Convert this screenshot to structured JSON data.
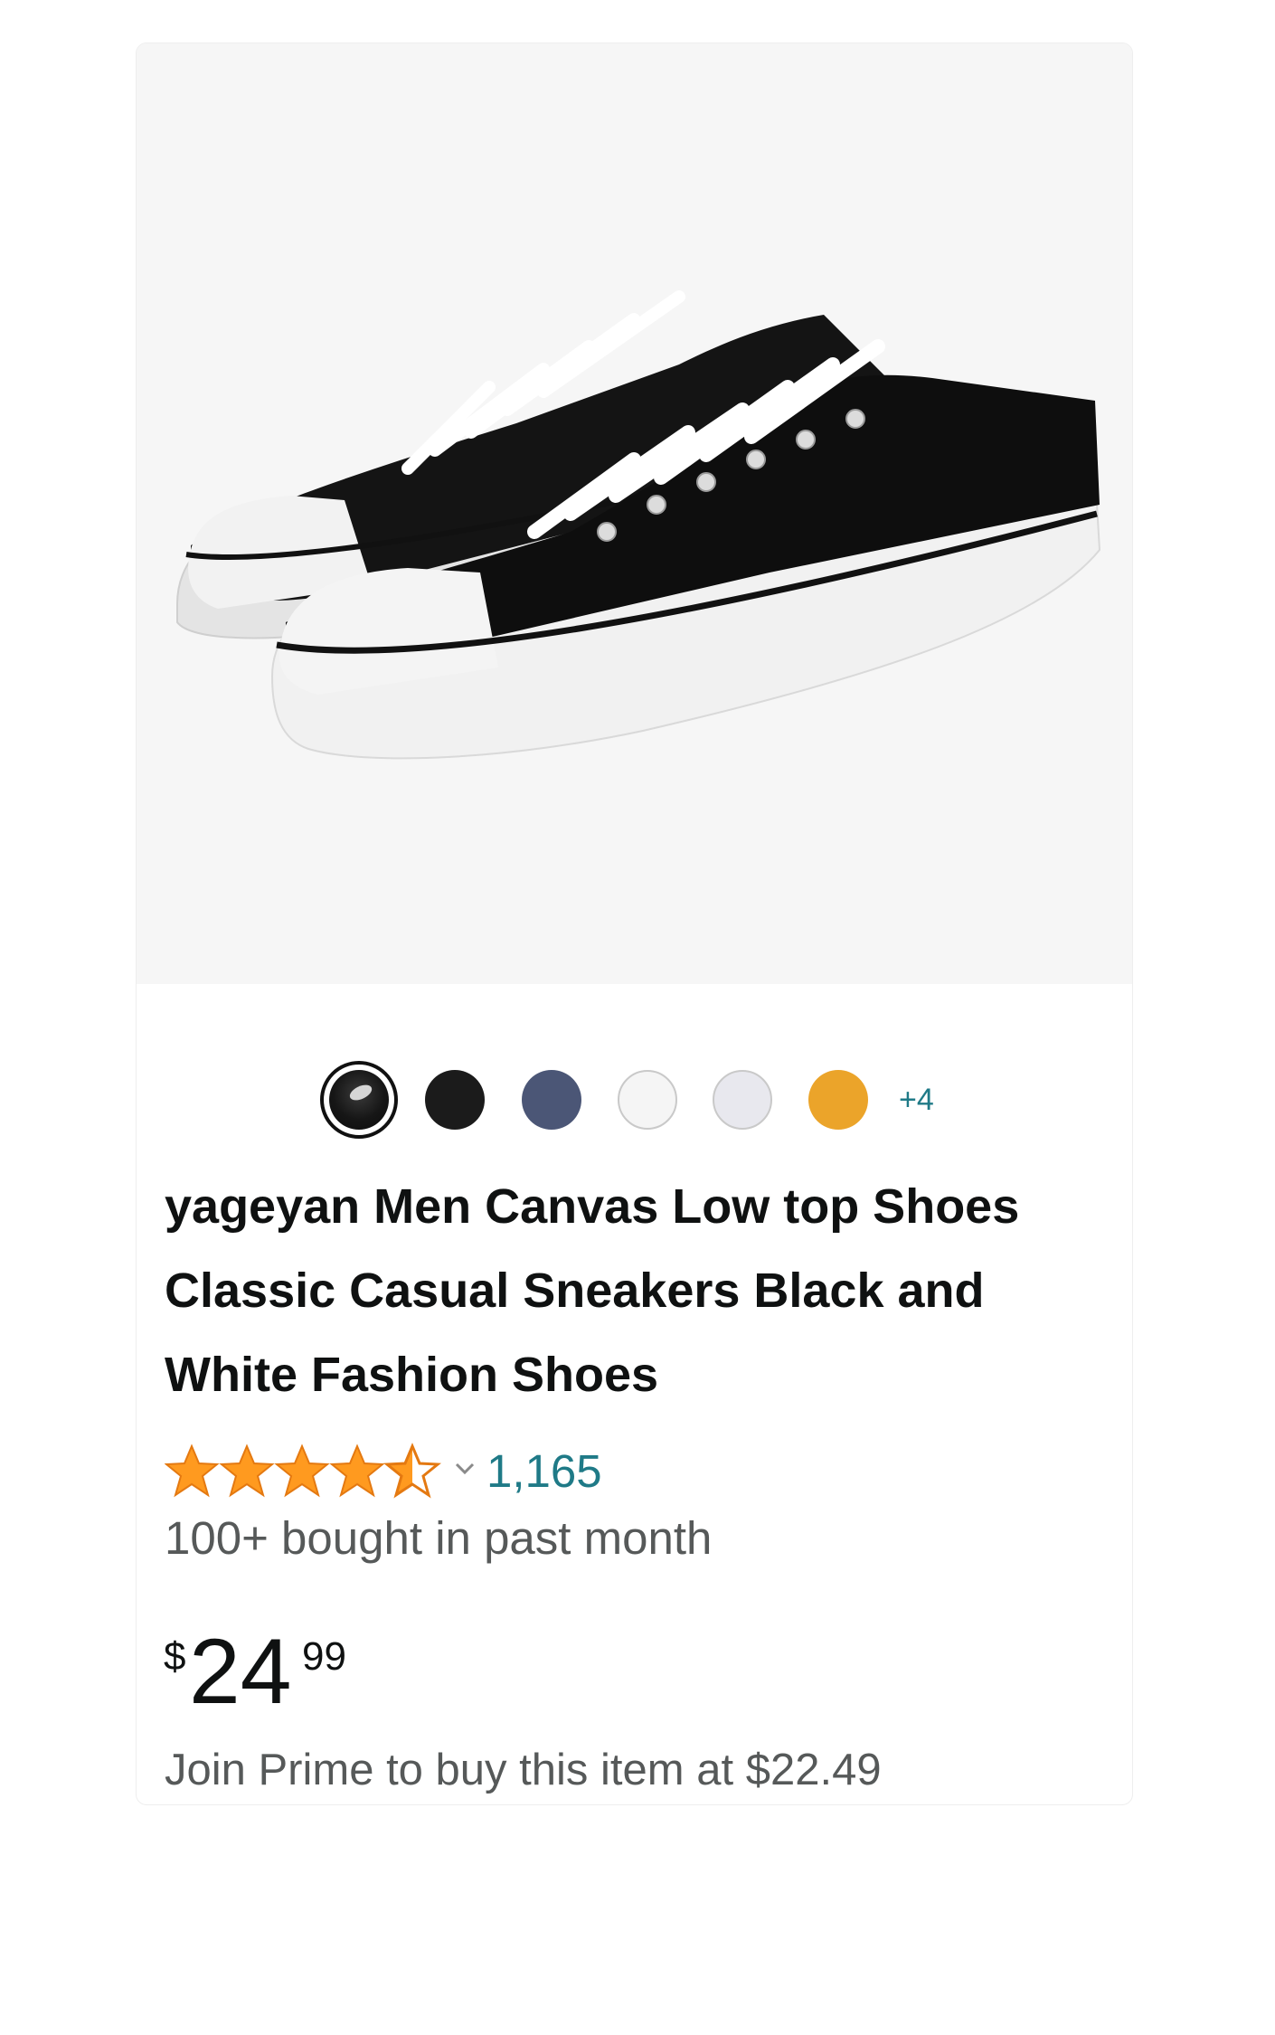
{
  "product": {
    "image_alt": "Black canvas low top sneakers with white laces and toe caps",
    "swatches": [
      {
        "color": "#111111",
        "selected": true
      },
      {
        "color": "#1b1b1b",
        "selected": false
      },
      {
        "color": "#4b5676",
        "selected": false
      },
      {
        "color": "#f5f5f5",
        "selected": false
      },
      {
        "color": "#e8e8ee",
        "selected": false
      },
      {
        "color": "#eba42a",
        "selected": false
      }
    ],
    "more_swatches_label": "+4",
    "title": "yageyan Men Canvas Low top Shoes Classic Casual Sneakers Black and White Fashion Shoes",
    "rating": 4.5,
    "review_count": "1,165",
    "bought_text": "100+ bought in past month",
    "price": {
      "symbol": "$",
      "whole": "24",
      "fraction": "99"
    },
    "prime_note": "Join Prime to buy this item at $22.49"
  },
  "colors": {
    "star": "#ff9a1f",
    "link": "#1f7a87",
    "text": "#0f1111",
    "secondary_text": "#565959"
  }
}
